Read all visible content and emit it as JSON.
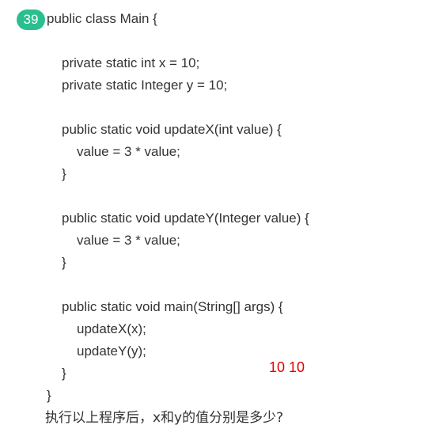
{
  "question": {
    "number": "39",
    "code_lines": [
      "public class Main {",
      "private static int x = 10;",
      "private static Integer y = 10;",
      "public static void updateX(int value) {",
      "value = 3 * value;",
      "}",
      "public static void updateY(Integer value) {",
      "value = 3 * value;",
      "}",
      "public static void main(String[] args) {",
      "updateX(x);",
      "updateY(y);",
      "}",
      "}"
    ],
    "prompt": "执行以上程序后，x和y的值分别是多少?",
    "handwritten_answer": "10 10"
  },
  "colors": {
    "badge": "#2bbf8f",
    "text": "#333333",
    "answer": "#e60000"
  }
}
